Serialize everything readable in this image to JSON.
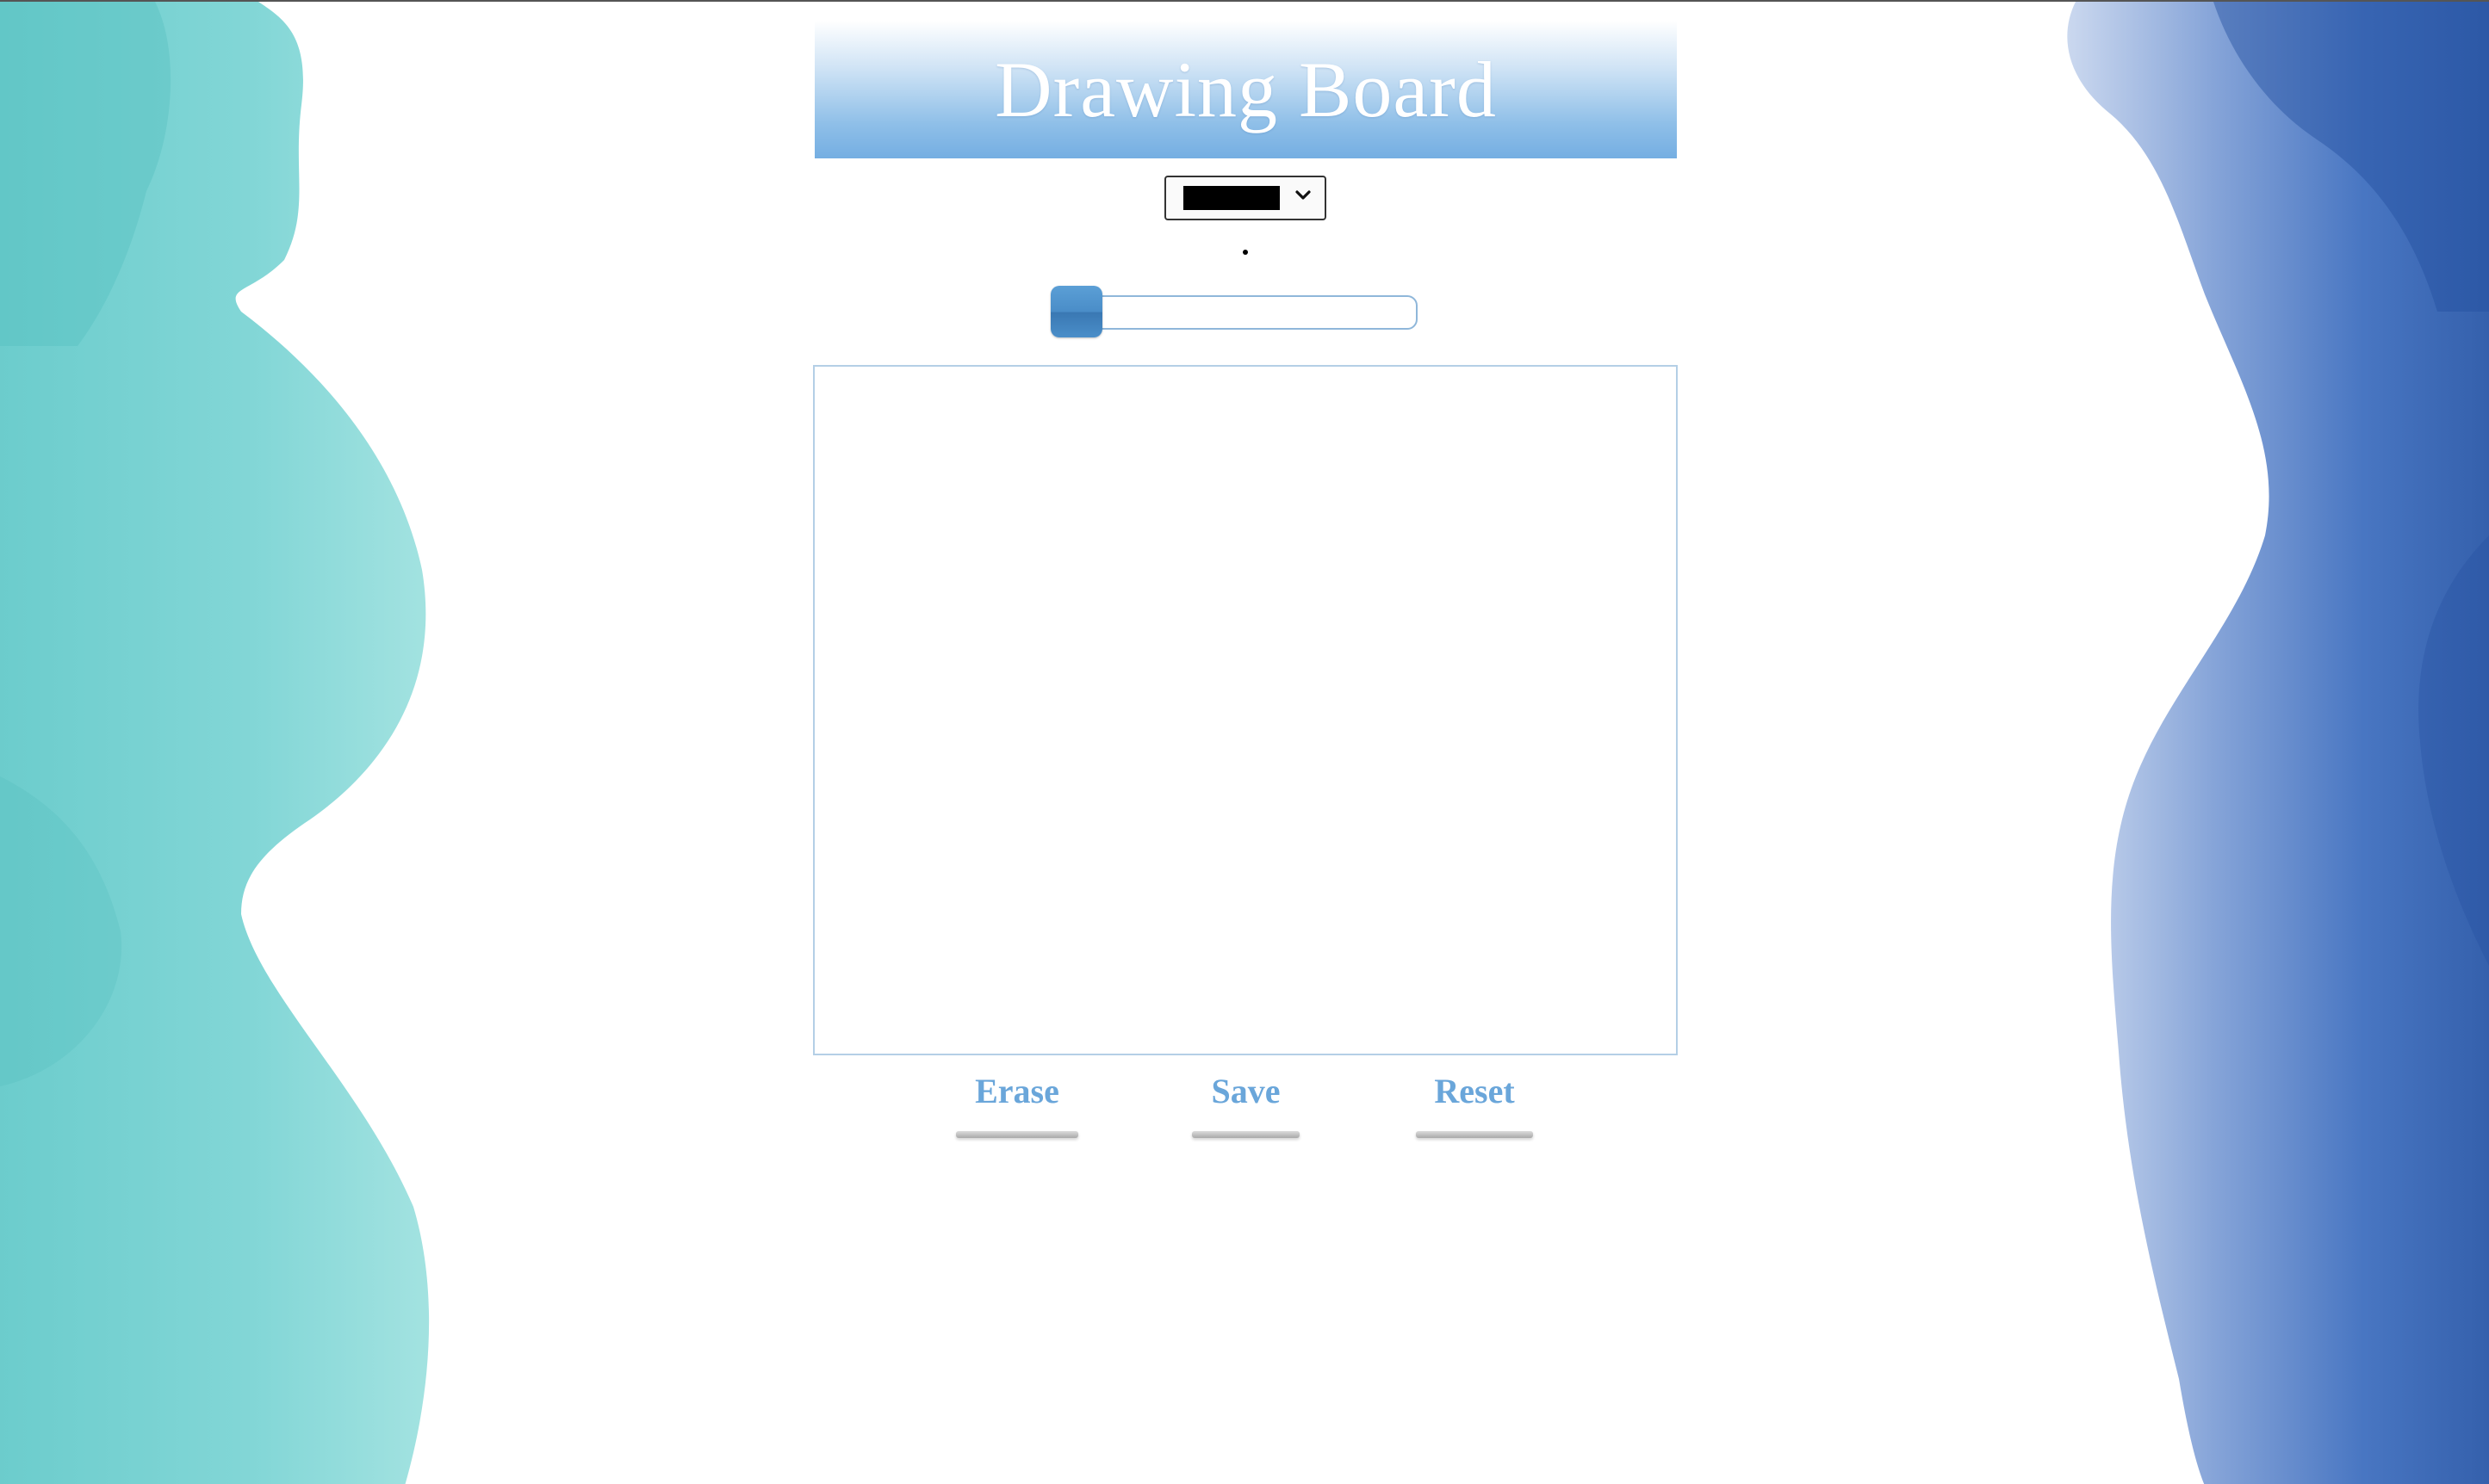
{
  "header": {
    "title": "Drawing Board"
  },
  "color_picker": {
    "selected_color": "#000000"
  },
  "brush_size": {
    "value_fraction": 0.0
  },
  "actions": {
    "erase_label": "Erase",
    "save_label": "Save",
    "reset_label": "Reset"
  },
  "colors": {
    "accent": "#6aa6da",
    "header_gradient_end": "#74aee2",
    "teal_art": "#6fcfcf",
    "navy_art": "#2f5fae"
  },
  "icons": {
    "select_arrow": "chevron-down-icon"
  }
}
